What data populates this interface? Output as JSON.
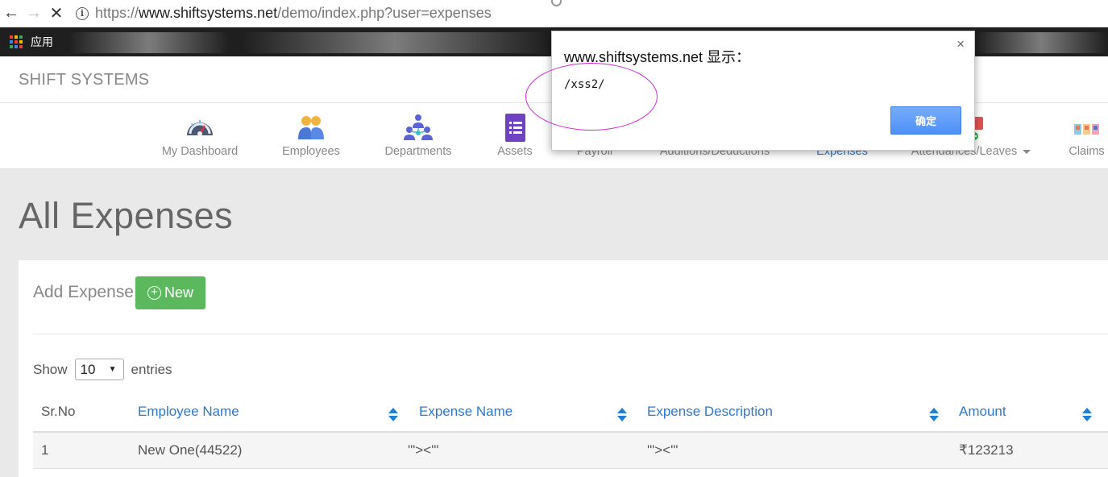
{
  "browser": {
    "url_scheme": "https://",
    "url_host": "www.shiftsystems.net",
    "url_path": "/demo/index.php?user=expenses",
    "bookmarks_apps_label": "应用"
  },
  "app": {
    "brand": "SHIFT SYSTEMS"
  },
  "nav": [
    {
      "label": "My Dashboard",
      "icon": "dashboard-gauge-icon"
    },
    {
      "label": "Employees",
      "icon": "employees-icon"
    },
    {
      "label": "Departments",
      "icon": "departments-icon"
    },
    {
      "label": "Assets",
      "icon": "assets-form-icon"
    },
    {
      "label": "Payroll",
      "icon": "payroll-icon"
    },
    {
      "label": "Additions/Deductions",
      "icon": "additions-deductions-icon"
    },
    {
      "label": "Expenses",
      "icon": "expenses-icon",
      "active": true
    },
    {
      "label": "Attendances/Leaves",
      "icon": "attendance-icon"
    },
    {
      "label": "Claims",
      "icon": "claims-icon"
    }
  ],
  "page": {
    "title": "All Expenses",
    "add_label": "Add Expense",
    "new_button": "New",
    "show_label": "Show",
    "entries_select": "10",
    "entries_label": "entries"
  },
  "table": {
    "headers": [
      "Sr.No",
      "Employee Name",
      "Expense Name",
      "Expense Description",
      "Amount"
    ],
    "rows": [
      [
        "1",
        "New One(44522)",
        "'\"><'\"",
        "'\"><'\"",
        "₹123213"
      ]
    ]
  },
  "dialog": {
    "title": "www.shiftsystems.net 显示：",
    "message": "/xss2/",
    "ok_button": "确定",
    "close": "×"
  },
  "colors": {
    "accent_blue": "#2a7ad2",
    "new_button_green": "#5cb85c",
    "annotation_ellipse": "#d22ad0"
  }
}
